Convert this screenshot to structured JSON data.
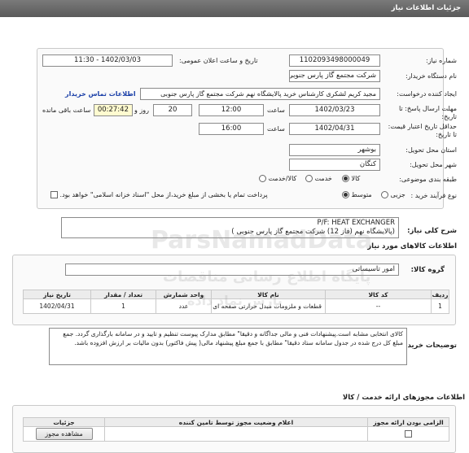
{
  "header": {
    "title": "جزئیات اطلاعات نیاز"
  },
  "fields": {
    "need_number_label": "شماره نیاز:",
    "need_number": "1102093498000049",
    "announce_label": "تاریخ و ساعت اعلان عمومی:",
    "announce_value": "1402/03/03 - 11:30",
    "buyer_label": "نام دستگاه خریدار:",
    "buyer_value": "شرکت مجتمع گاز پارس جنوبی",
    "creator_label": "ایجاد کننده درخواست:",
    "creator_value": "مجید کریم لشکری کارشناس خرید پالایشگاه نهم شرکت مجتمع گاز پارس جنوبی",
    "contact_link": "اطلاعات تماس خریدار",
    "deadline_label": "مهلت ارسال پاسخ: تا تاریخ:",
    "deadline_date": "1402/03/23",
    "time_label": "ساعت",
    "deadline_time": "12:00",
    "days_value": "20",
    "days_label": "روز و",
    "remaining_value": "00:27:42",
    "remaining_label": "ساعت باقی مانده",
    "validity_label": "حداقل تاریخ اعتبار قیمت: تا تاریخ:",
    "validity_date": "1402/04/31",
    "validity_time": "16:00",
    "province_label": "استان محل تحویل:",
    "province_value": "بوشهر",
    "city_label": "شهر محل تحویل:",
    "city_value": "کنگان",
    "category_label": "طبقه بندی موضوعی:",
    "category_options": [
      "کالا",
      "خدمت",
      "کالا/خدمت"
    ],
    "process_label": "نوع فرآیند خرید :",
    "process_options": [
      "جزیی",
      "متوسط"
    ],
    "payment_note": "پرداخت تمام یا بخشی از مبلغ خرید،از محل \"اسناد خزانه اسلامی\" خواهد بود."
  },
  "description": {
    "label": "شرح کلی نیاز:",
    "line1": "P/F: HEAT EXCHANGER",
    "line2": "(پالایشگاه نهم (فاز 12) شرکت مجتمع گاز پارس جنوبی )"
  },
  "goods_section_title": "اطلاعات کالاهای مورد نیاز",
  "goods_group_label": "گروه کالا:",
  "goods_group_value": "امور تاسیساتی",
  "goods_table": {
    "headers": [
      "ردیف",
      "کد کالا",
      "نام کالا",
      "واحد شمارش",
      "تعداد / مقدار",
      "تاریخ نیاز"
    ],
    "rows": [
      [
        "1",
        "--",
        "قطعات و ملزومات مبدل حرارتی صفحه ای",
        "عدد",
        "1",
        "1402/04/31"
      ]
    ]
  },
  "buyer_notes_label": "توضیحات خریدار:",
  "buyer_notes_text": "کالای انتخابی مشابه است.پیشنهادات فنی و مالی جداگانه و دقیقا\" مطابق مدارک پیوست تنظیم و تایید و در سامانه بارگذاری گردد. جمع مبلغ کل درج شده در جدول سامانه ستاد دقیقا\" مطابق با جمع مبلغ پیشنهاد مالی( پیش فاکتور) بدون مالیات بر ارزش افزوده باشد.",
  "provider_section_title": "اطلاعات مجوزهای ارائه خدمت / کالا",
  "provider_table": {
    "headers": [
      "الزامی بودن ارائه مجوز",
      "اعلام وضعیت مجوز توسط تامین کننده",
      "جزئیات"
    ],
    "view_button": "مشاهده مجوز"
  },
  "watermark": {
    "brand": "ParsNamadData",
    "fa": "پایگاه اطلاع رسانی مناقصات",
    "fa2": "پارس نماد داده"
  }
}
